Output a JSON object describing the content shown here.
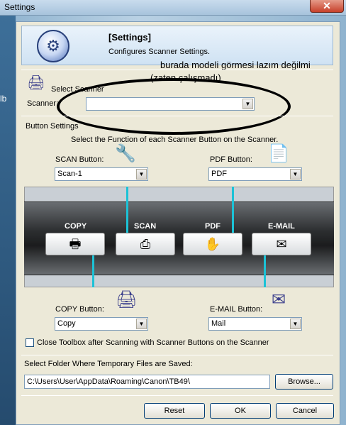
{
  "window": {
    "title": "Settings",
    "close": "✕"
  },
  "desktop": {
    "label": "lb"
  },
  "header": {
    "title": "[Settings]",
    "subtitle": "Configures Scanner Settings."
  },
  "annotation": {
    "line1": "burada modeli görmesi lazım değilmi",
    "line2": "(zaten çalışmadı)"
  },
  "select_scanner": {
    "label": "Select Scanner",
    "scanner_label": "Scanner:",
    "scanner_value": ""
  },
  "button_settings": {
    "label": "Button Settings",
    "instruction": "Select the Function of each Scanner Button on the Scanner.",
    "scan": {
      "label": "SCAN Button:",
      "value": "Scan-1"
    },
    "pdf": {
      "label": "PDF Button:",
      "value": "PDF"
    },
    "copy": {
      "label": "COPY Button:",
      "value": "Copy"
    },
    "email": {
      "label": "E-MAIL Button:",
      "value": "Mail"
    }
  },
  "scanner_panel": {
    "copy": "COPY",
    "scan": "SCAN",
    "pdf": "PDF",
    "email": "E-MAIL"
  },
  "close_toolbox": {
    "label": "Close Toolbox after Scanning with Scanner Buttons on the Scanner",
    "checked": false
  },
  "temp_folder": {
    "label": "Select Folder Where Temporary Files are Saved:",
    "path": "C:\\Users\\User\\AppData\\Roaming\\Canon\\TB49\\",
    "browse": "Browse..."
  },
  "footer": {
    "reset": "Reset",
    "ok": "OK",
    "cancel": "Cancel"
  },
  "icons": {
    "header": "settings-gear-icon",
    "scanner": "scanner-icon",
    "scan": "scan-tools-icon",
    "pdf": "pdf-document-icon",
    "copy": "printer-icon",
    "email": "email-icon"
  }
}
